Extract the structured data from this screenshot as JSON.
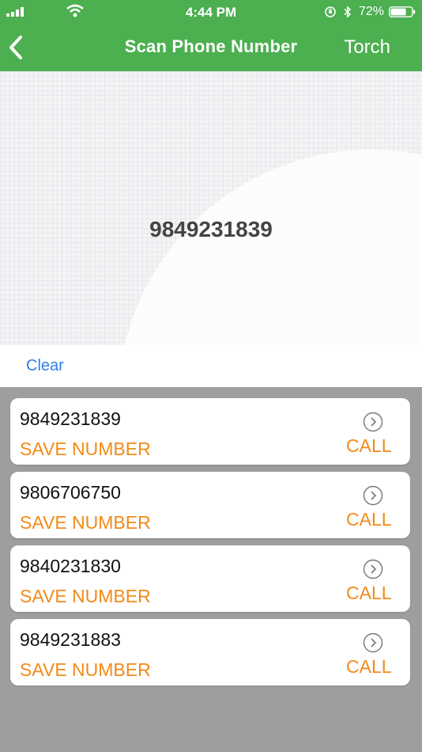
{
  "status_bar": {
    "time": "4:44 PM",
    "battery": "72%",
    "icons": [
      "signal-icon",
      "wifi-icon",
      "orientation-lock-icon",
      "bluetooth-icon",
      "battery-icon"
    ]
  },
  "navbar": {
    "title": "Scan Phone Number",
    "torch_label": "Torch",
    "back_icon": "chevron-left-icon"
  },
  "scan": {
    "detected_number": "9849231839"
  },
  "actions": {
    "clear_label": "Clear"
  },
  "results": [
    {
      "number": "9849231839",
      "save_label": "SAVE NUMBER",
      "call_label": "CALL"
    },
    {
      "number": "9806706750",
      "save_label": "SAVE NUMBER",
      "call_label": "CALL"
    },
    {
      "number": "9840231830",
      "save_label": "SAVE NUMBER",
      "call_label": "CALL"
    },
    {
      "number": "9849231883",
      "save_label": "SAVE NUMBER",
      "call_label": "CALL"
    }
  ],
  "colors": {
    "header": "#4caf50",
    "accent": "#f28a18",
    "link": "#2f7fe4",
    "list_background": "#9e9e9e"
  }
}
